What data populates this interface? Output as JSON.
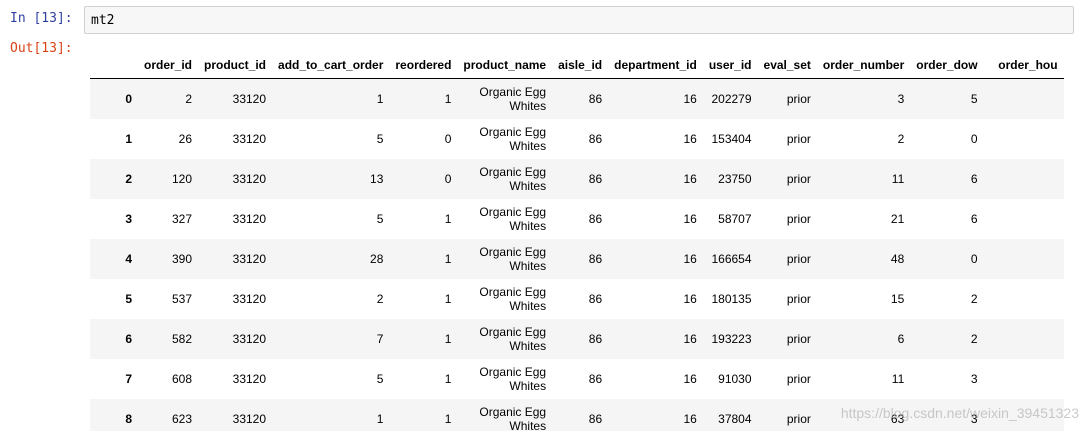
{
  "input_prompt": "In [13]:",
  "output_prompt": "Out[13]:",
  "code": "mt2",
  "columns": [
    "",
    "order_id",
    "product_id",
    "add_to_cart_order",
    "reordered",
    "product_name",
    "aisle_id",
    "department_id",
    "user_id",
    "eval_set",
    "order_number",
    "order_dow",
    "order_hou"
  ],
  "rows": [
    [
      "0",
      "2",
      "33120",
      "1",
      "1",
      "Organic Egg Whites",
      "86",
      "16",
      "202279",
      "prior",
      "3",
      "5"
    ],
    [
      "1",
      "26",
      "33120",
      "5",
      "0",
      "Organic Egg Whites",
      "86",
      "16",
      "153404",
      "prior",
      "2",
      "0"
    ],
    [
      "2",
      "120",
      "33120",
      "13",
      "0",
      "Organic Egg Whites",
      "86",
      "16",
      "23750",
      "prior",
      "11",
      "6"
    ],
    [
      "3",
      "327",
      "33120",
      "5",
      "1",
      "Organic Egg Whites",
      "86",
      "16",
      "58707",
      "prior",
      "21",
      "6"
    ],
    [
      "4",
      "390",
      "33120",
      "28",
      "1",
      "Organic Egg Whites",
      "86",
      "16",
      "166654",
      "prior",
      "48",
      "0"
    ],
    [
      "5",
      "537",
      "33120",
      "2",
      "1",
      "Organic Egg Whites",
      "86",
      "16",
      "180135",
      "prior",
      "15",
      "2"
    ],
    [
      "6",
      "582",
      "33120",
      "7",
      "1",
      "Organic Egg Whites",
      "86",
      "16",
      "193223",
      "prior",
      "6",
      "2"
    ],
    [
      "7",
      "608",
      "33120",
      "5",
      "1",
      "Organic Egg Whites",
      "86",
      "16",
      "91030",
      "prior",
      "11",
      "3"
    ],
    [
      "8",
      "623",
      "33120",
      "1",
      "1",
      "Organic Egg Whites",
      "86",
      "16",
      "37804",
      "prior",
      "63",
      "3"
    ]
  ],
  "watermark": "https://blog.csdn.net/weixin_39451323"
}
